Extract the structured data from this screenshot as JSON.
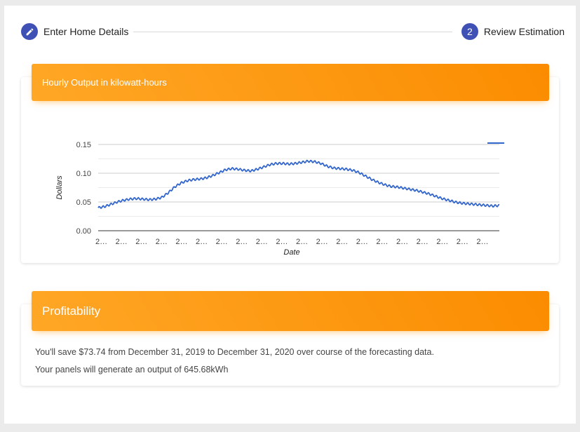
{
  "stepper": {
    "step1_label": "Enter Home Details",
    "step2_number": "2",
    "step2_label": "Review Estimation"
  },
  "output_card": {
    "title": "Hourly Output in kilowatt-hours"
  },
  "profitability_card": {
    "title": "Profitability",
    "savings_text": "You'll save $73.74 from December 31, 2019 to December 31, 2020 over course of the forecasting data.",
    "output_text": "Your panels will generate an output of 645.68kWh"
  },
  "colors": {
    "accent": "#3f51b5",
    "header_start": "#ffa726",
    "header_end": "#fb8c00",
    "series": "#3366cc"
  },
  "chart_data": {
    "type": "line",
    "xlabel": "Date",
    "ylabel": "Dollars",
    "ylim": [
      0,
      0.15
    ],
    "yticks": [
      "0.00",
      "0.05",
      "0.10",
      "0.15"
    ],
    "xtick_labels": [
      "2…",
      "2…",
      "2…",
      "2…",
      "2…",
      "2…",
      "2…",
      "2…",
      "2…",
      "2…",
      "2…",
      "2…",
      "2…",
      "2…",
      "2…",
      "2…",
      "2…",
      "2…",
      "2…",
      "2…"
    ],
    "grid": true,
    "legend": "right",
    "series": [
      {
        "values": [
          0.04,
          0.042,
          0.046,
          0.05,
          0.053,
          0.055,
          0.056,
          0.055,
          0.054,
          0.055,
          0.058,
          0.066,
          0.076,
          0.083,
          0.087,
          0.089,
          0.09,
          0.092,
          0.096,
          0.101,
          0.106,
          0.108,
          0.107,
          0.105,
          0.104,
          0.107,
          0.111,
          0.115,
          0.117,
          0.117,
          0.116,
          0.117,
          0.119,
          0.121,
          0.12,
          0.117,
          0.112,
          0.109,
          0.108,
          0.107,
          0.105,
          0.101,
          0.095,
          0.089,
          0.084,
          0.08,
          0.077,
          0.076,
          0.074,
          0.072,
          0.07,
          0.067,
          0.064,
          0.06,
          0.056,
          0.053,
          0.05,
          0.048,
          0.047,
          0.046,
          0.045,
          0.044,
          0.043,
          0.044
        ]
      }
    ]
  }
}
